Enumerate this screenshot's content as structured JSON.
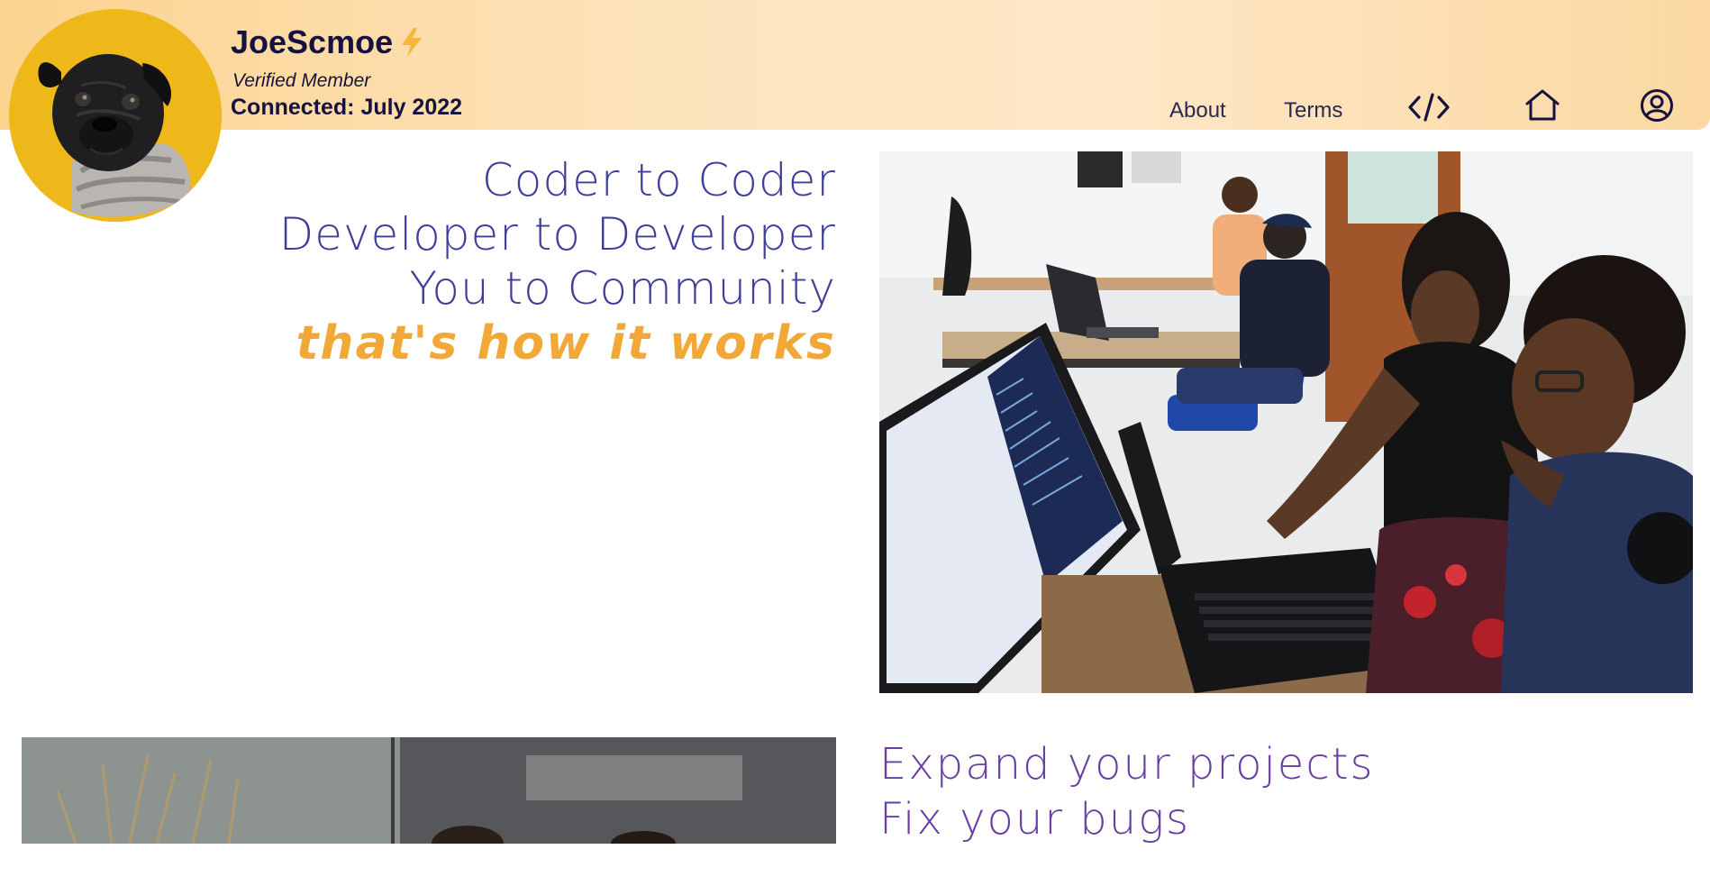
{
  "profile": {
    "name": "JoeScmoe",
    "badge": "Verified Member",
    "connected": "Connected: July 2022",
    "avatar_icon": "pug-avatar",
    "name_icon": "lightning-bolt-icon",
    "avatar_bg": "#efb81a"
  },
  "nav": {
    "about": "About",
    "terms": "Terms",
    "code_icon": "code-icon",
    "home_icon": "home-icon",
    "account_icon": "user-account-icon"
  },
  "hero": {
    "line1": "Coder to Coder",
    "line2": "Developer to Developer",
    "line3": "You to Community",
    "tagline": "that's how it works"
  },
  "features": {
    "line1": "Expand your projects",
    "line2": "Fix your bugs"
  },
  "colors": {
    "header_start": "#fcd38f",
    "header_end": "#ffe7c6",
    "hero_text": "#3f3f9a",
    "accent": "#f2a837",
    "features_text": "#6a3fa3",
    "dark_text": "#16123f"
  }
}
